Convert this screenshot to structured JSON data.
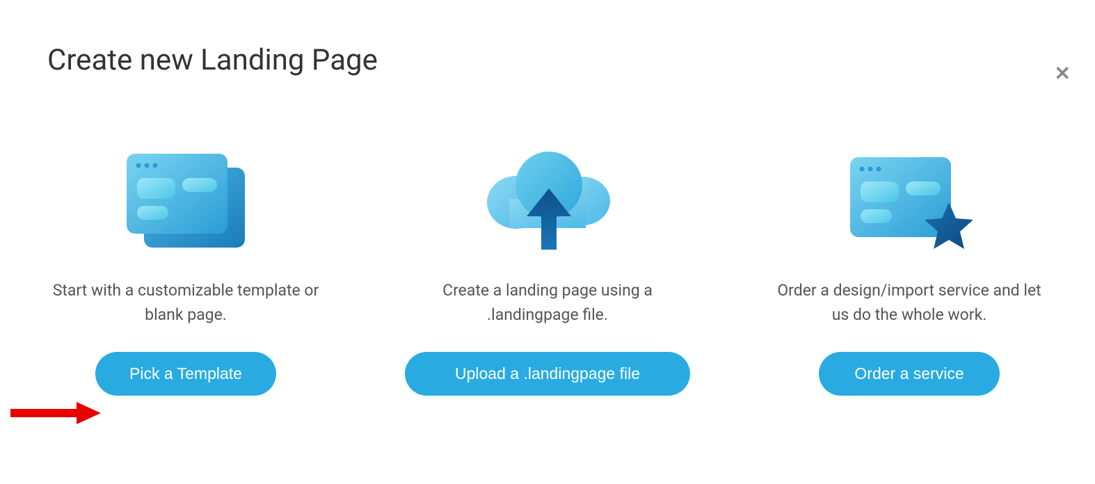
{
  "title": "Create new Landing Page",
  "options": {
    "template": {
      "desc": "Start with a customizable template or blank page.",
      "button": "Pick a Template"
    },
    "upload": {
      "desc": "Create a landing page using a .landingpage file.",
      "button": "Upload a .landingpage file"
    },
    "service": {
      "desc": "Order a design/import service and let us do the whole work.",
      "button": "Order a service"
    }
  },
  "colors": {
    "primary": "#29abe2",
    "lightBlue": "#5ac8e8",
    "darkBlue": "#0d5a9e"
  }
}
